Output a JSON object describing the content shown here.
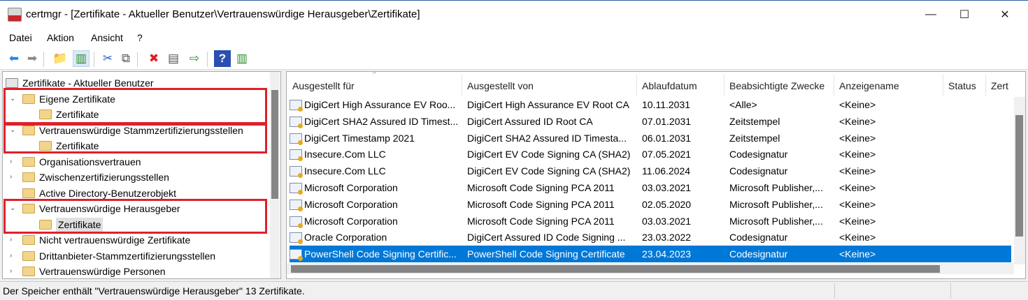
{
  "window": {
    "title": "certmgr - [Zertifikate - Aktueller Benutzer\\Vertrauenswürdige Herausgeber\\Zertifikate]",
    "minimize": "—",
    "maximize": "☐",
    "close": "✕"
  },
  "menu": [
    "Datei",
    "Aktion",
    "Ansicht",
    "?"
  ],
  "toolbar": [
    {
      "icon": "back-arrow-icon",
      "glyph": "⬅",
      "color": "#1e88e5"
    },
    {
      "icon": "forward-arrow-icon",
      "glyph": "➡",
      "color": "#888"
    },
    {
      "icon": "up-folder-icon",
      "glyph": "📁",
      "color": "#c9a54a"
    },
    {
      "icon": "show-hide-tree-icon",
      "glyph": "▥",
      "color": "#2a8a2a"
    },
    {
      "icon": "cut-icon",
      "glyph": "✂",
      "color": "#2a60c0"
    },
    {
      "icon": "copy-icon",
      "glyph": "⧉",
      "color": "#555"
    },
    {
      "icon": "delete-icon",
      "glyph": "✖",
      "color": "#e02020"
    },
    {
      "icon": "properties-icon",
      "glyph": "▤",
      "color": "#555"
    },
    {
      "icon": "export-icon",
      "glyph": "⇨",
      "color": "#2a8a2a"
    },
    {
      "icon": "help-icon",
      "glyph": "?",
      "color": "#fff"
    },
    {
      "icon": "action-pane-icon",
      "glyph": "▥",
      "color": "#2a8a2a"
    }
  ],
  "tree": [
    {
      "label": "Zertifikate - Aktueller Benutzer",
      "level": 0,
      "chevron": "",
      "root": true
    },
    {
      "label": "Eigene Zertifikate",
      "level": 1,
      "chevron": "⌄"
    },
    {
      "label": "Zertifikate",
      "level": 2,
      "chevron": ""
    },
    {
      "label": "Vertrauenswürdige Stammzertifizierungsstellen",
      "level": 1,
      "chevron": "⌄"
    },
    {
      "label": "Zertifikate",
      "level": 2,
      "chevron": ""
    },
    {
      "label": "Organisationsvertrauen",
      "level": 1,
      "chevron": "›"
    },
    {
      "label": "Zwischenzertifizierungsstellen",
      "level": 1,
      "chevron": "›"
    },
    {
      "label": "Active Directory-Benutzerobjekt",
      "level": 1,
      "chevron": ""
    },
    {
      "label": "Vertrauenswürdige Herausgeber",
      "level": 1,
      "chevron": "⌄"
    },
    {
      "label": "Zertifikate",
      "level": 2,
      "chevron": "",
      "selected": true
    },
    {
      "label": "Nicht vertrauenswürdige Zertifikate",
      "level": 1,
      "chevron": "›"
    },
    {
      "label": "Drittanbieter-Stammzertifizierungsstellen",
      "level": 1,
      "chevron": "›"
    },
    {
      "label": "Vertrauenswürdige Personen",
      "level": 1,
      "chevron": "›"
    }
  ],
  "columns": [
    "Ausgestellt für",
    "Ausgestellt von",
    "Ablaufdatum",
    "Beabsichtigte Zwecke",
    "Anzeigename",
    "Status",
    "Zert"
  ],
  "sort_indicator": "^",
  "rows": [
    [
      "DigiCert High Assurance EV Roo...",
      "DigiCert High Assurance EV Root CA",
      "10.11.2031",
      "<Alle>",
      "<Keine>"
    ],
    [
      "DigiCert SHA2 Assured ID Timest...",
      "DigiCert Assured ID Root CA",
      "07.01.2031",
      "Zeitstempel",
      "<Keine>"
    ],
    [
      "DigiCert Timestamp 2021",
      "DigiCert SHA2 Assured ID Timesta...",
      "06.01.2031",
      "Zeitstempel",
      "<Keine>"
    ],
    [
      "Insecure.Com LLC",
      "DigiCert EV Code Signing CA (SHA2)",
      "07.05.2021",
      "Codesignatur",
      "<Keine>"
    ],
    [
      "Insecure.Com LLC",
      "DigiCert EV Code Signing CA (SHA2)",
      "11.06.2024",
      "Codesignatur",
      "<Keine>"
    ],
    [
      "Microsoft Corporation",
      "Microsoft Code Signing PCA 2011",
      "03.03.2021",
      "Microsoft Publisher,...",
      "<Keine>"
    ],
    [
      "Microsoft Corporation",
      "Microsoft Code Signing PCA 2011",
      "02.05.2020",
      "Microsoft Publisher,...",
      "<Keine>"
    ],
    [
      "Microsoft Corporation",
      "Microsoft Code Signing PCA 2011",
      "03.03.2021",
      "Microsoft Publisher,...",
      "<Keine>"
    ],
    [
      "Oracle Corporation",
      "DigiCert Assured ID Code Signing ...",
      "23.03.2022",
      "Codesignatur",
      "<Keine>"
    ],
    [
      "PowerShell Code Signing Certific...",
      "PowerShell Code Signing Certificate",
      "23.04.2023",
      "Codesignatur",
      "<Keine>"
    ]
  ],
  "selected_row": 9,
  "status": "Der Speicher enthält \"Vertrauenswürdige Herausgeber\" 13 Zertifikate.",
  "colors": {
    "selection": "#0078d7",
    "highlight_box": "#e0202a"
  }
}
